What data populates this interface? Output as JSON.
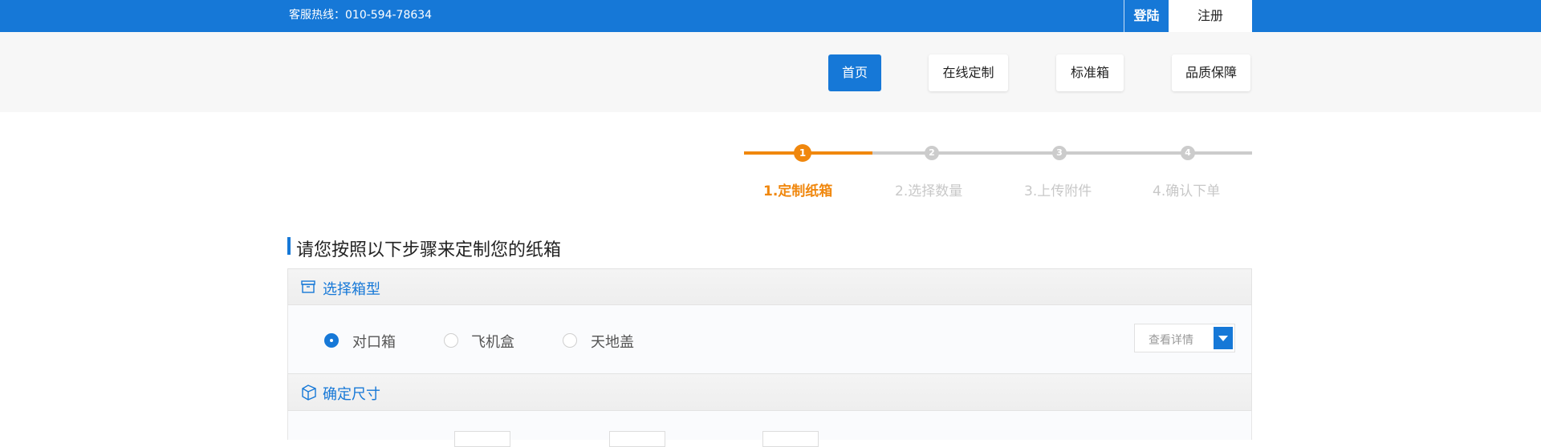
{
  "topbar": {
    "hotline": "客服热线：010-594-78634",
    "login_label": "登陆",
    "register_label": "注册"
  },
  "nav": {
    "items": [
      {
        "label": "首页",
        "active": true
      },
      {
        "label": "在线定制",
        "active": false
      },
      {
        "label": "标准箱",
        "active": false
      },
      {
        "label": "品质保障",
        "active": false
      }
    ]
  },
  "steps": [
    {
      "num": "1",
      "label": "1.定制纸箱",
      "active": true
    },
    {
      "num": "2",
      "label": "2.选择数量",
      "active": false
    },
    {
      "num": "3",
      "label": "3.上传附件",
      "active": false
    },
    {
      "num": "4",
      "label": "4.确认下单",
      "active": false
    }
  ],
  "main": {
    "heading": "请您按照以下步骤来定制您的纸箱",
    "box_type_panel": {
      "title": "选择箱型",
      "icon": "box-icon",
      "options": [
        {
          "label": "对口箱",
          "checked": true
        },
        {
          "label": "飞机盒",
          "checked": false
        },
        {
          "label": "天地盖",
          "checked": false
        }
      ],
      "details_select": "查看详情"
    },
    "size_panel": {
      "title": "确定尺寸",
      "icon": "ruler-box-icon"
    }
  },
  "colors": {
    "brand_blue": "#1678d7",
    "step_orange": "#f0870d",
    "inactive_gray": "#cccccc"
  }
}
